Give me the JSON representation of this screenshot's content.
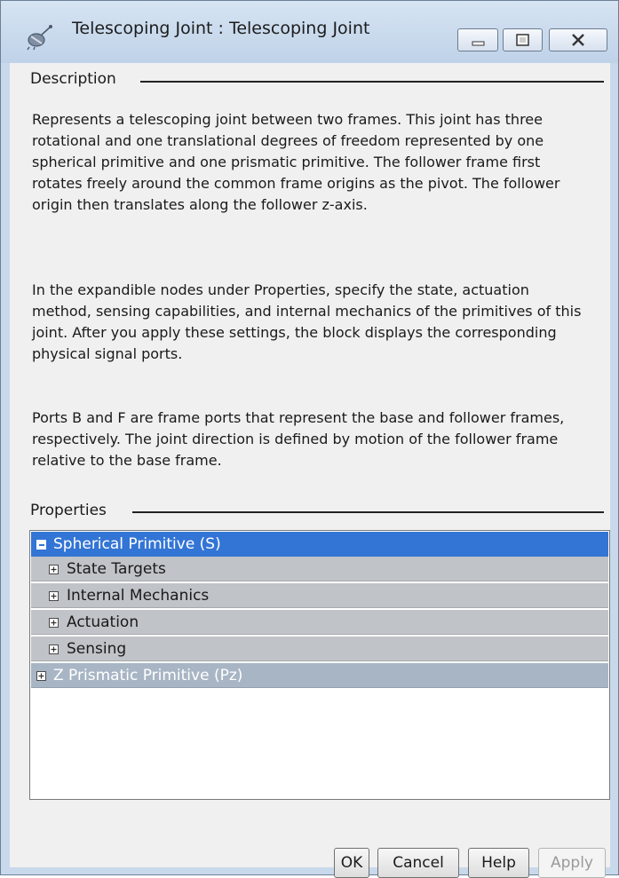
{
  "window": {
    "title": "Telescoping Joint : Telescoping Joint",
    "icon": "satellite-icon",
    "controls": [
      "minimize-icon",
      "maximize-icon",
      "close-icon"
    ]
  },
  "description": {
    "header": "Description",
    "paragraphs": [
      "Represents a telescoping joint between two frames. This joint has three rotational and one translational degrees of freedom represented by one spherical primitive and one prismatic primitive. The follower frame first rotates freely around the common frame origins as the pivot. The follower origin then translates along the follower z-axis.",
      "In the expandible nodes under Properties, specify the state, actuation method, sensing capabilities, and internal mechanics of the primitives of this joint. After you apply these settings, the block displays the corresponding physical signal ports.",
      "Ports B and F are frame ports that represent the base and follower frames, respectively. The joint direction is defined by motion of the follower frame relative to the base frame."
    ]
  },
  "properties": {
    "header": "Properties",
    "tree": [
      {
        "label": "Spherical Primitive (S)",
        "expanded": true,
        "selected": true
      },
      {
        "label": "State Targets",
        "expanded": false
      },
      {
        "label": "Internal Mechanics",
        "expanded": false
      },
      {
        "label": "Actuation",
        "expanded": false
      },
      {
        "label": "Sensing",
        "expanded": false
      },
      {
        "label": "Z Prismatic Primitive (Pz)",
        "expanded": false
      }
    ]
  },
  "buttons": {
    "ok": "OK",
    "cancel": "Cancel",
    "help": "Help",
    "apply": "Apply"
  },
  "colors": {
    "selection": "#3375d5",
    "titlebar": "#c9d9ec"
  }
}
